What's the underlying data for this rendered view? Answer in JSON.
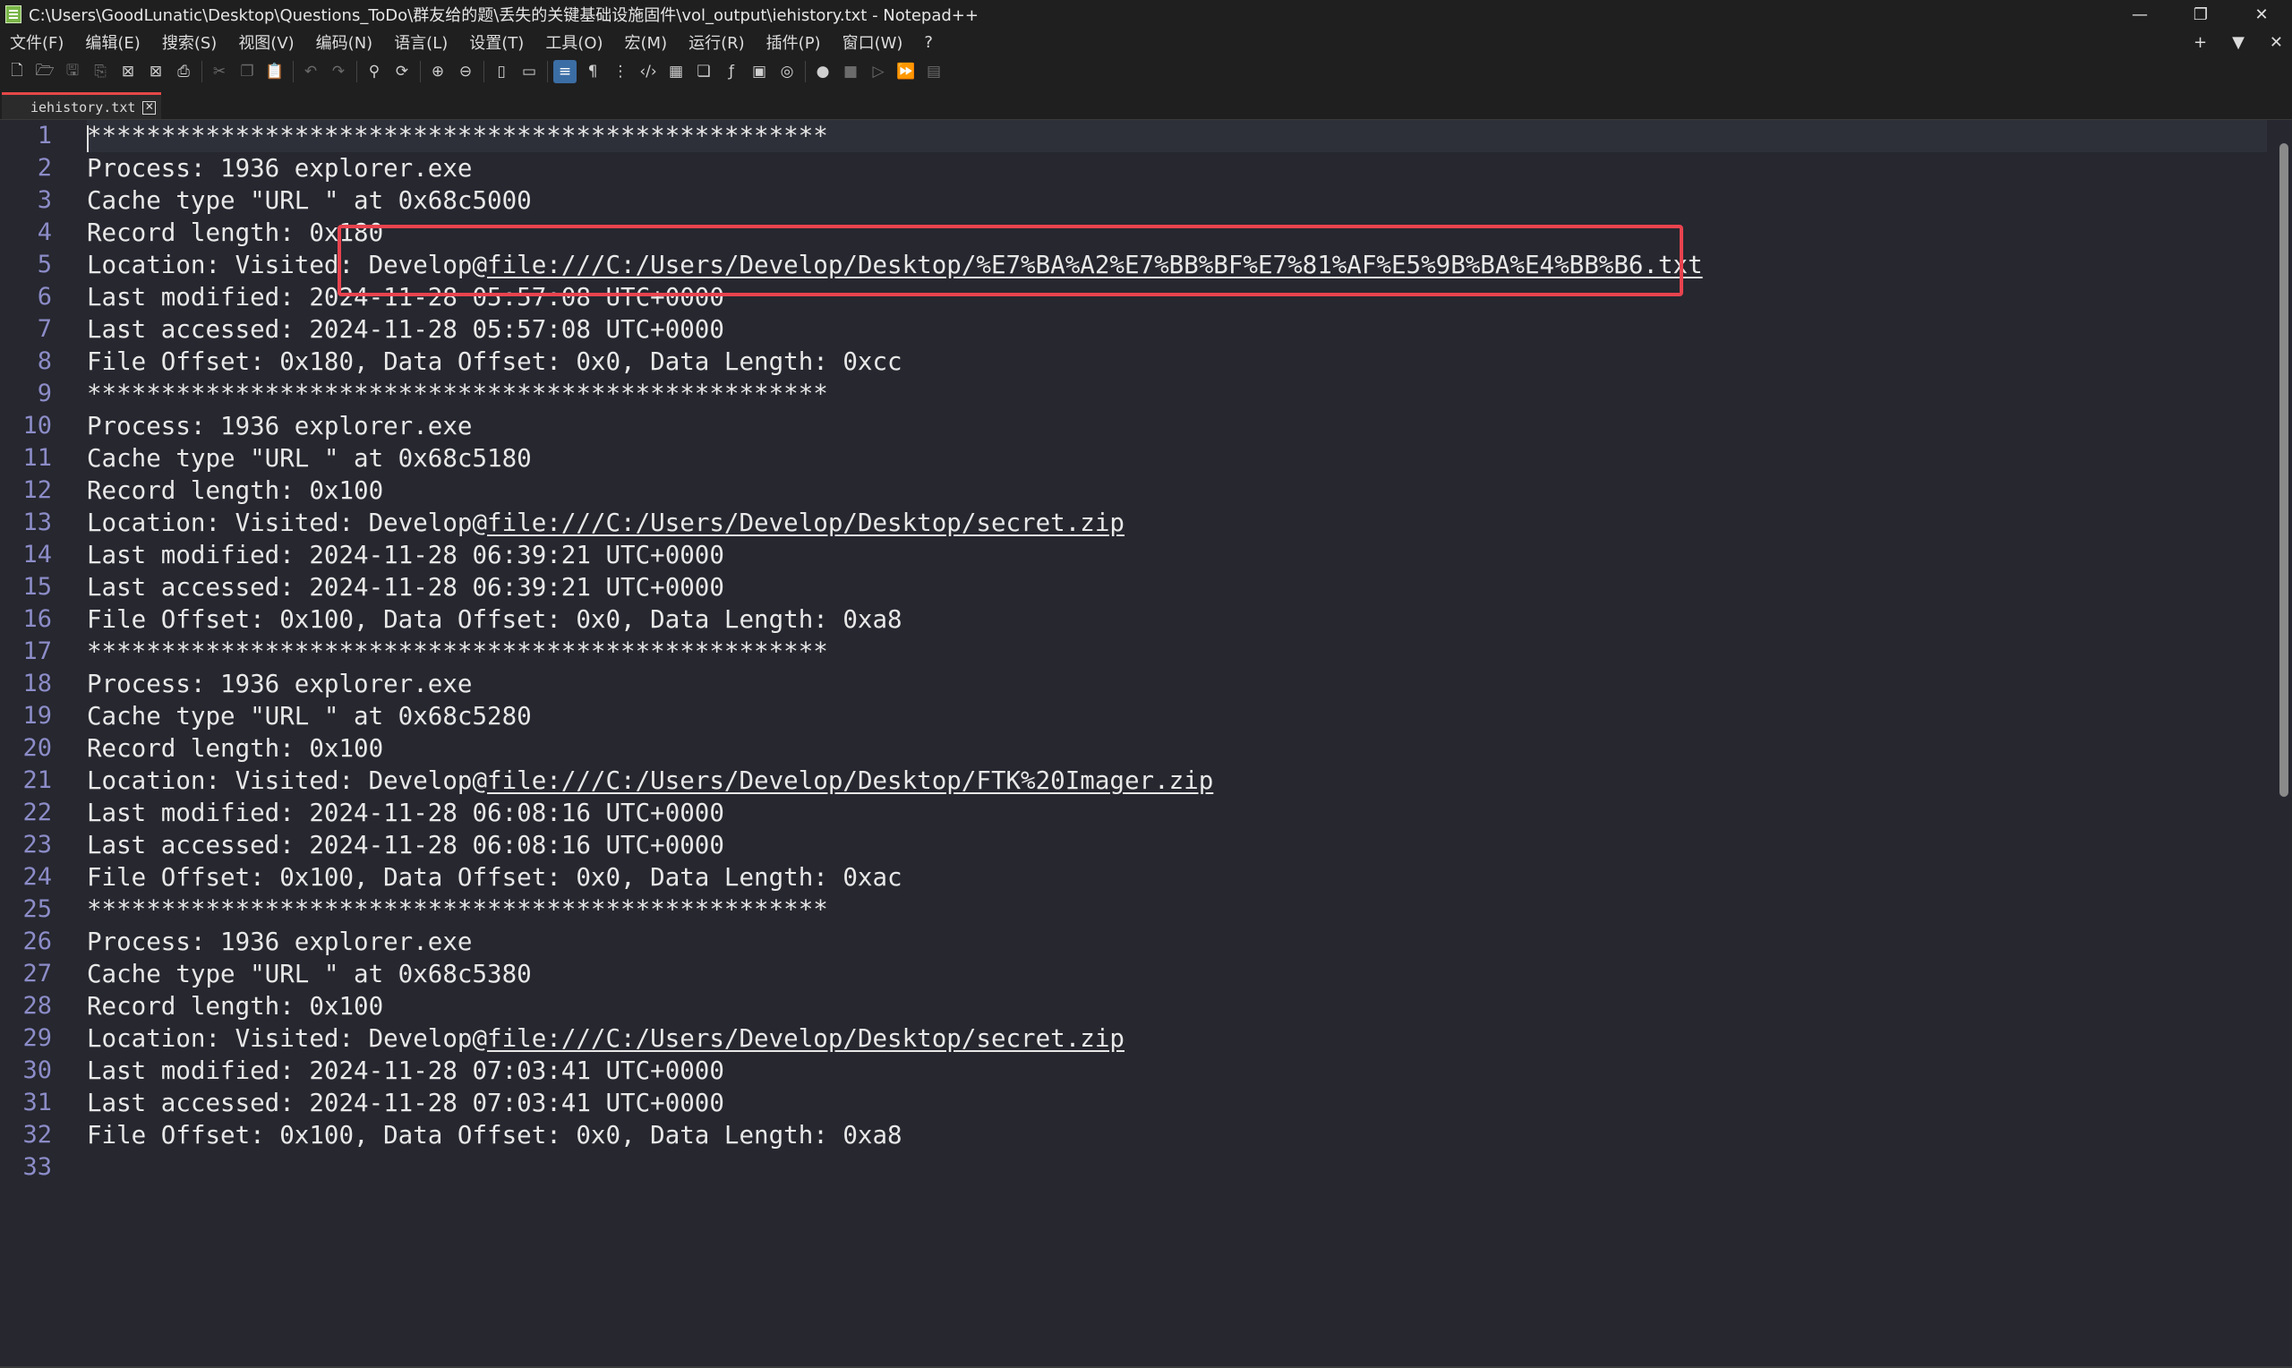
{
  "window": {
    "title": "C:\\Users\\GoodLunatic\\Desktop\\Questions_ToDo\\群友给的题\\丢失的关键基础设施固件\\vol_output\\iehistory.txt - Notepad++",
    "minimize": "—",
    "restore": "❐",
    "close": "✕"
  },
  "menu": {
    "items": [
      "文件(F)",
      "编辑(E)",
      "搜索(S)",
      "视图(V)",
      "编码(N)",
      "语言(L)",
      "设置(T)",
      "工具(O)",
      "宏(M)",
      "运行(R)",
      "插件(P)",
      "窗口(W)",
      "?"
    ],
    "right_plus": "+",
    "right_down": "▼",
    "right_close": "✕"
  },
  "toolbar": {
    "icons": [
      "new-file-icon",
      "open-file-icon",
      "save-icon",
      "save-all-icon",
      "close-icon",
      "close-all-icon",
      "print-icon",
      "cut-icon",
      "copy-icon",
      "paste-icon",
      "undo-icon",
      "redo-icon",
      "find-icon",
      "replace-icon",
      "zoom-in-icon",
      "zoom-out-icon",
      "sync-vertical-icon",
      "sync-horizontal-icon",
      "word-wrap-icon",
      "show-all-chars-icon",
      "indent-guide-icon",
      "xml-tag-icon",
      "document-map-icon",
      "document-list-icon",
      "function-list-icon",
      "folder-workspace-icon",
      "monitoring-icon",
      "record-macro-icon",
      "stop-macro-icon",
      "play-macro-icon",
      "run-macro-multiple-icon",
      "save-macro-icon"
    ]
  },
  "tab": {
    "label": "iehistory.txt",
    "close": "✕"
  },
  "editor": {
    "lines": [
      "**************************************************",
      "Process: 1936 explorer.exe",
      "Cache type \"URL \" at 0x68c5000",
      "Record length: 0x180",
      "Location: Visited: Develop@file:///C:/Users/Develop/Desktop/%E7%BA%A2%E7%BB%BF%E7%81%AF%E5%9B%BA%E4%BB%B6.txt",
      "Last modified: 2024-11-28 05:57:08 UTC+0000",
      "Last accessed: 2024-11-28 05:57:08 UTC+0000",
      "File Offset: 0x180, Data Offset: 0x0, Data Length: 0xcc",
      "**************************************************",
      "Process: 1936 explorer.exe",
      "Cache type \"URL \" at 0x68c5180",
      "Record length: 0x100",
      "Location: Visited: Develop@file:///C:/Users/Develop/Desktop/secret.zip",
      "Last modified: 2024-11-28 06:39:21 UTC+0000",
      "Last accessed: 2024-11-28 06:39:21 UTC+0000",
      "File Offset: 0x100, Data Offset: 0x0, Data Length: 0xa8",
      "**************************************************",
      "Process: 1936 explorer.exe",
      "Cache type \"URL \" at 0x68c5280",
      "Record length: 0x100",
      "Location: Visited: Develop@file:///C:/Users/Develop/Desktop/FTK%20Imager.zip",
      "Last modified: 2024-11-28 06:08:16 UTC+0000",
      "Last accessed: 2024-11-28 06:08:16 UTC+0000",
      "File Offset: 0x100, Data Offset: 0x0, Data Length: 0xac",
      "**************************************************",
      "Process: 1936 explorer.exe",
      "Cache type \"URL \" at 0x68c5380",
      "Record length: 0x100",
      "Location: Visited: Develop@file:///C:/Users/Develop/Desktop/secret.zip",
      "Last modified: 2024-11-28 07:03:41 UTC+0000",
      "Last accessed: 2024-11-28 07:03:41 UTC+0000",
      "File Offset: 0x100, Data Offset: 0x0, Data Length: 0xa8",
      ""
    ],
    "current_line": 1,
    "highlighted_line": 5
  },
  "colors": {
    "background": "#26272f",
    "line_number": "#8c8cc8",
    "text": "#e8e8e8",
    "highlight_box": "#e8434f",
    "tab_accent": "#e64848"
  }
}
